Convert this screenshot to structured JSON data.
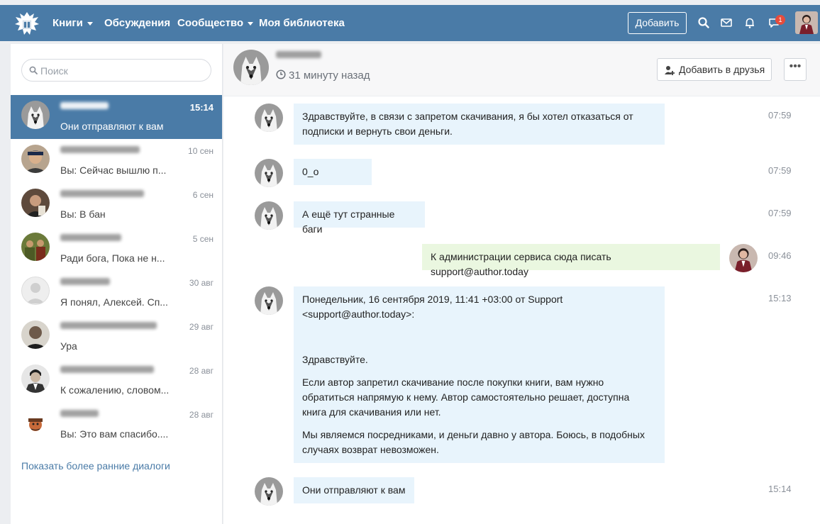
{
  "nav": {
    "books": "Книги",
    "discussions": "Обсуждения",
    "community": "Сообщество",
    "library": "Моя библиотека",
    "add": "Добавить",
    "notification_badge": "1"
  },
  "sidebar": {
    "search_placeholder": "Поиск",
    "dialogs": [
      {
        "date": "15:14",
        "preview": "Они отправляют к вам",
        "active": true
      },
      {
        "date": "10 сен",
        "preview": "Вы: Сейчас вышлю п..."
      },
      {
        "date": "6 сен",
        "preview": "Вы: В бан"
      },
      {
        "date": "5 сен",
        "preview": "Ради бога, Пока не н..."
      },
      {
        "date": "30 авг",
        "preview": "Я понял, Алексей. Сп..."
      },
      {
        "date": "29 авг",
        "preview": "Ура"
      },
      {
        "date": "28 авг",
        "preview": "К сожалению, словом..."
      },
      {
        "date": "28 авг",
        "preview": "Вы: Это вам спасибо...."
      }
    ],
    "show_earlier": "Показать более ранние диалоги"
  },
  "chat": {
    "last_seen": "31 минуту назад",
    "add_friend": "Добавить в друзья",
    "more": "•••",
    "messages": [
      {
        "text": "Здравствуйте, в связи с запретом скачивания, я бы хотел отказаться от подписки и вернуть свои деньги.",
        "time": "07:59"
      },
      {
        "text": "0_о",
        "time": "07:59"
      },
      {
        "text": "А ещё тут странные баги",
        "time": "07:59"
      },
      {
        "text": "К администрации сервиса сюда писать support@author.today",
        "time": "09:46"
      },
      {
        "time": "15:13",
        "header": "Понедельник, 16 сентября 2019, 11:41 +03:00 от Support <support@author.today>:",
        "greeting": "Здравствуйте.",
        "para1": "Если автор запретил скачивание после покупки книги, вам нужно обратиться напрямую к нему. Автор самостоятельно решает, доступна книга для скачивания или нет.",
        "para2": "Мы являемся посредниками, и деньги давно у автора. Боюсь, в подобных случаях возврат невозможен."
      },
      {
        "text": "Они отправляют к вам",
        "time": "15:14"
      }
    ]
  },
  "colors": {
    "brand": "#4a7ba7",
    "incoming_bubble": "#e8f4fc",
    "outgoing_bubble": "#eaf7e0"
  }
}
